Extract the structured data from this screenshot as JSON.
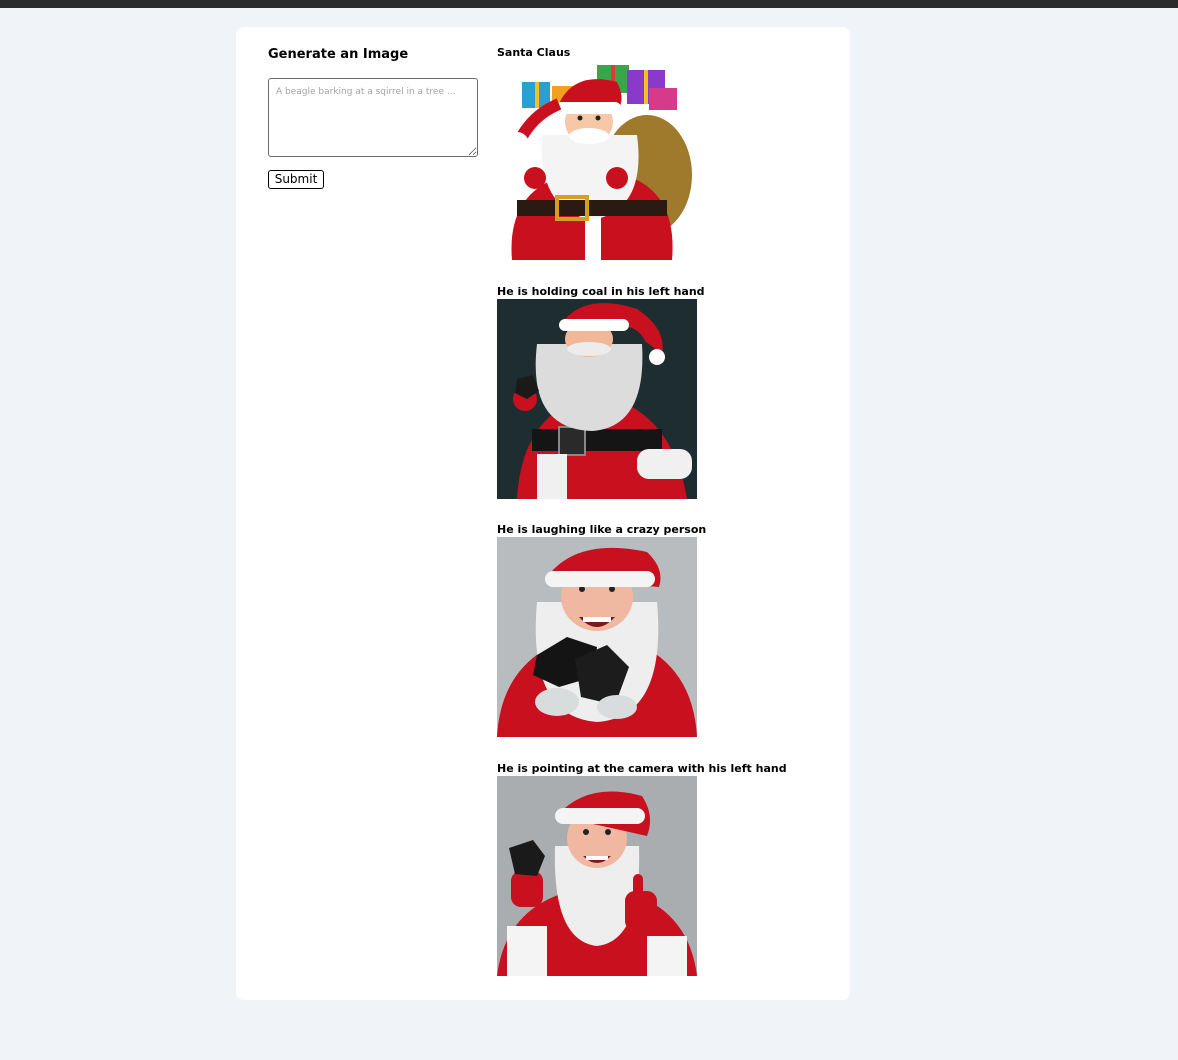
{
  "form": {
    "title": "Generate an Image",
    "prompt_value": "",
    "prompt_placeholder": "A beagle barking at a sqirrel in a tree ...",
    "submit_label": "Submit"
  },
  "feed": [
    {
      "caption": "Santa Claus",
      "image": "santa-with-gift-sack-illustration"
    },
    {
      "caption": "He is holding coal in his left hand",
      "image": "santa-holding-coal"
    },
    {
      "caption": "He is laughing like a crazy person",
      "image": "santa-laughing-with-coal"
    },
    {
      "caption": "He is pointing at the camera with his left hand",
      "image": "santa-pointing-at-camera"
    }
  ],
  "colors": {
    "page_background": "#f0f4f8",
    "card_background": "#ffffff",
    "santa_red": "#c8101e"
  }
}
